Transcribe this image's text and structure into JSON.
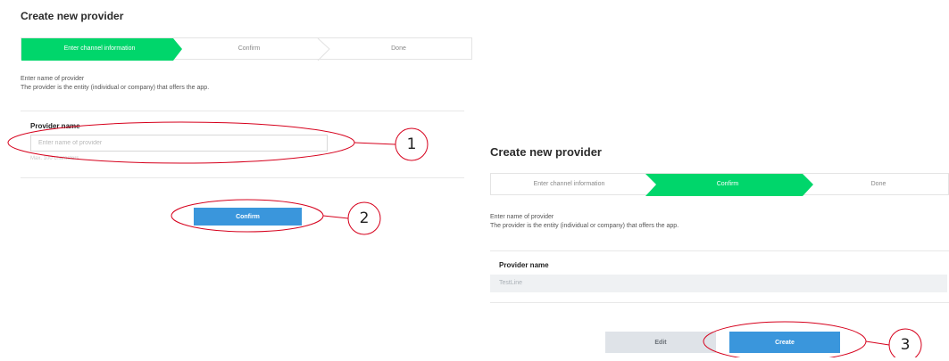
{
  "colors": {
    "step_active": "#00d66b",
    "primary_button": "#3a96dc",
    "secondary_button": "#dfe3e8",
    "annotation": "#d6001c"
  },
  "left": {
    "title": "Create new provider",
    "steps": [
      {
        "label": "Enter channel information",
        "active": true
      },
      {
        "label": "Confirm",
        "active": false
      },
      {
        "label": "Done",
        "active": false
      }
    ],
    "desc_line1": "Enter name of provider",
    "desc_line2": "The provider is the entity (individual or company) that offers the app.",
    "field_label": "Provider name",
    "input_placeholder": "Enter name of provider",
    "input_value": "",
    "hint": "Max. 100 characters",
    "confirm_label": "Confirm"
  },
  "right": {
    "title": "Create new provider",
    "steps": [
      {
        "label": "Enter channel information",
        "active": false
      },
      {
        "label": "Confirm",
        "active": true
      },
      {
        "label": "Done",
        "active": false
      }
    ],
    "desc_line1": "Enter name of provider",
    "desc_line2": "The provider is the entity (individual or company) that offers the app.",
    "field_label": "Provider name",
    "provider_value": "TestLine",
    "edit_label": "Edit",
    "create_label": "Create"
  },
  "annotations": {
    "callout_1": "1",
    "callout_2": "2",
    "callout_3": "3"
  }
}
